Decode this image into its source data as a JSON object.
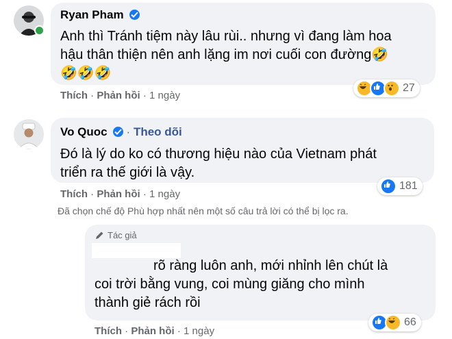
{
  "comments": [
    {
      "author": "Ryan Pham",
      "verified": true,
      "follow_label": "",
      "text_lines": [
        "Anh thì Tránh tiệm này lâu rùi.. nhưng vì đang làm hoa",
        "hậu thân thiện nên anh lặng im nơi cuối con đường🤣",
        "🤣🤣🤣"
      ],
      "like_label": "Thích",
      "reply_label": "Phản hồi",
      "time": "1 ngày",
      "reaction_count": "27"
    },
    {
      "author": "Vo Quoc",
      "verified": true,
      "follow_label": "Theo dõi",
      "text_lines": [
        "Đó là lý do ko có thương hiệu nào của Vietnam phát",
        "triển ra thế giới là vậy."
      ],
      "like_label": "Thích",
      "reply_label": "Phản hồi",
      "time": "1 ngày",
      "reaction_count": "181"
    }
  ],
  "filter_notice": "Đã chọn chế độ Phù hợp nhất nên một số câu trả lời có thể bị lọc ra.",
  "reply": {
    "badge": "Tác giả",
    "text_lines": [
      "rõ ràng luôn anh, mới nhỉnh lên chút là",
      "coi trời bằng vung, coi mùng giăng cho mình",
      "thành giẻ rách rồi"
    ],
    "like_label": "Thích",
    "reply_label": "Phản hồi",
    "time": "1 ngày",
    "reaction_count": "66"
  },
  "colors": {
    "link": "#385898",
    "verified": "#1877f2",
    "bubble": "#f0f2f5",
    "online": "#31a24c"
  }
}
